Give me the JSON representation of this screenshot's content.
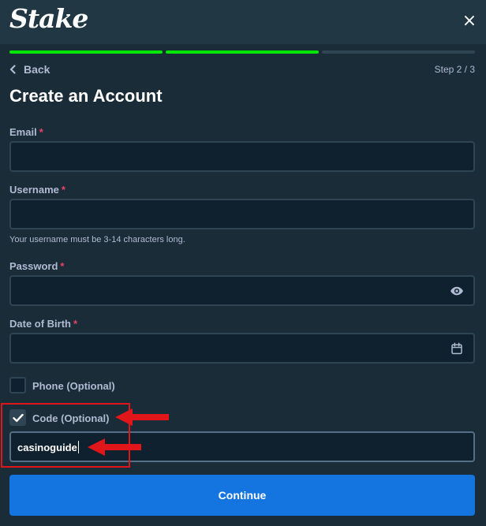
{
  "brand": {
    "logo": "Stake"
  },
  "header": {
    "close_glyph": "×"
  },
  "progress": {
    "total_steps": 3,
    "completed_steps": 2,
    "active_color": "#00e701",
    "inactive_color": "#2f4553"
  },
  "nav": {
    "back_label": "Back",
    "step_text": "Step 2 / 3"
  },
  "form": {
    "title": "Create an Account",
    "required_marker": "*",
    "email": {
      "label": "Email",
      "value": ""
    },
    "username": {
      "label": "Username",
      "value": "",
      "hint": "Your username must be 3-14 characters long."
    },
    "password": {
      "label": "Password",
      "value": "",
      "toggle_icon": "eye-icon"
    },
    "dob": {
      "label": "Date of Birth",
      "value": "",
      "picker_icon": "calendar-icon"
    },
    "phone": {
      "label": "Phone (Optional)",
      "checked": false
    },
    "code": {
      "label": "Code (Optional)",
      "checked": true,
      "value": "casinoguide"
    },
    "continue_label": "Continue"
  },
  "colors": {
    "accent": "#1475e1",
    "annotation": "#e0161b",
    "required": "#ed4163",
    "background": "#1a2c38"
  }
}
